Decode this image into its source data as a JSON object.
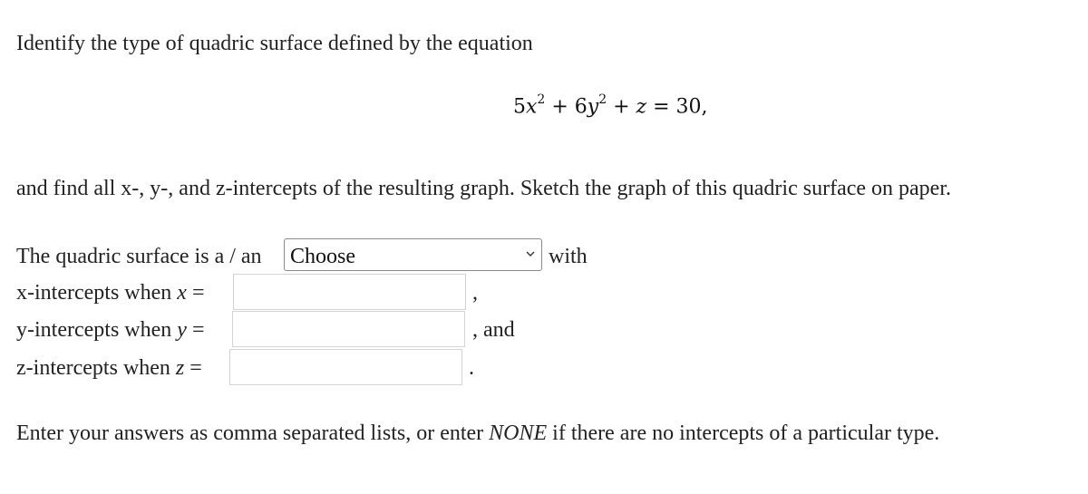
{
  "question": {
    "intro": "Identify the type of quadric surface defined by the equation",
    "equation": {
      "terms": [
        "5",
        "x",
        "2",
        " + 6",
        "y",
        "2",
        " + ",
        "z",
        " = 30,"
      ],
      "display": "5x² + 6y² + z = 30,"
    },
    "instruction": "and find all x-, y-, and z-intercepts of the resulting graph. Sketch the graph of this quadric surface on paper."
  },
  "form": {
    "surface_label": "The quadric surface is a / an",
    "surface_select": {
      "selected": "Choose"
    },
    "surface_suffix": "with",
    "x_intercepts": {
      "label": "x-intercepts when",
      "var": "x",
      "eq": "=",
      "value": "",
      "suffix": ","
    },
    "y_intercepts": {
      "label": "y-intercepts when",
      "var": "y",
      "eq": "=",
      "value": "",
      "suffix": ", and"
    },
    "z_intercepts": {
      "label": "z-intercepts when",
      "var": "z",
      "eq": "=",
      "value": "",
      "suffix": "."
    }
  },
  "note": {
    "before": "Enter your answers as comma separated lists, or enter",
    "emphasis": "NONE",
    "after": "if there are no intercepts of a particular type."
  }
}
